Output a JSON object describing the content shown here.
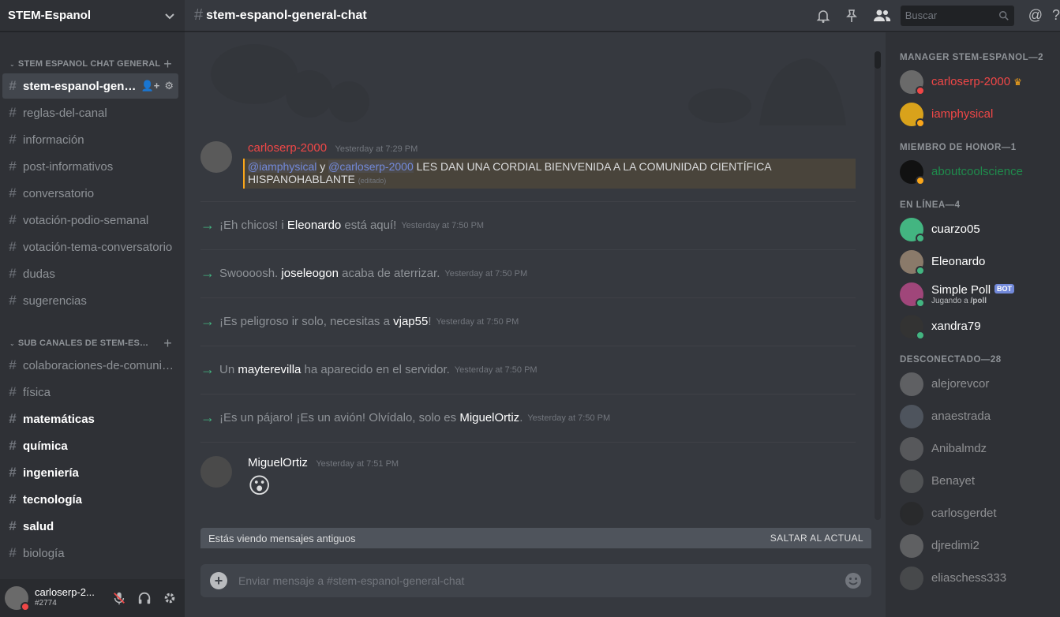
{
  "server": {
    "name": "STEM-Espanol"
  },
  "categories": [
    {
      "name": "STEM ESPANOL CHAT GENERAL",
      "channels": [
        {
          "name": "stem-espanol-general-chat",
          "state": "active"
        },
        {
          "name": "reglas-del-canal",
          "state": "normal"
        },
        {
          "name": "información",
          "state": "normal"
        },
        {
          "name": "post-informativos",
          "state": "normal"
        },
        {
          "name": "conversatorio",
          "state": "normal"
        },
        {
          "name": "votación-podio-semanal",
          "state": "normal"
        },
        {
          "name": "votación-tema-conversatorio",
          "state": "normal"
        },
        {
          "name": "dudas",
          "state": "normal"
        },
        {
          "name": "sugerencias",
          "state": "normal"
        }
      ]
    },
    {
      "name": "SUB CANALES DE STEM-ESPANOL",
      "channels": [
        {
          "name": "colaboraciones-de-comunidad",
          "state": "normal"
        },
        {
          "name": "física",
          "state": "normal"
        },
        {
          "name": "matemáticas",
          "state": "unread"
        },
        {
          "name": "química",
          "state": "unread"
        },
        {
          "name": "ingeniería",
          "state": "unread"
        },
        {
          "name": "tecnología",
          "state": "unread"
        },
        {
          "name": "salud",
          "state": "unread"
        },
        {
          "name": "biología",
          "state": "normal"
        }
      ]
    }
  ],
  "user_panel": {
    "username": "carloserp-2...",
    "tag": "#2774"
  },
  "topbar": {
    "channel_name": "stem-espanol-general-chat",
    "search_placeholder": "Buscar"
  },
  "messages": {
    "first": {
      "author": "carloserp-2000",
      "author_color": "#f04747",
      "timestamp": "Yesterday at 7:29 PM",
      "mention1": "@iamphysical",
      "joiner": "y",
      "mention2": "@carloserp-2000",
      "text": "LES DAN UNA CORDIAL BIENVENIDA A LA COMUNIDAD CIENTÍFICA HISPANOHABLANTE",
      "edited": "(editado)"
    },
    "system": [
      {
        "before": "¡Eh chicos! i ",
        "user": "Eleonardo",
        "after": " está aquí!",
        "timestamp": "Yesterday at 7:50 PM"
      },
      {
        "before": "Swoooosh. ",
        "user": "joseleogon",
        "after": " acaba de aterrizar.",
        "timestamp": "Yesterday at 7:50 PM"
      },
      {
        "before": "¡Es peligroso ir solo, necesitas a ",
        "user": "vjap55",
        "after": "!",
        "timestamp": "Yesterday at 7:50 PM"
      },
      {
        "before": "Un ",
        "user": "mayterevilla",
        "after": " ha aparecido en el servidor.",
        "timestamp": "Yesterday at 7:50 PM"
      },
      {
        "before": "¡Es un pájaro! ¡Es un avión! Olvídalo, solo es ",
        "user": "MiguelOrtiz",
        "after": ".",
        "timestamp": "Yesterday at 7:50 PM"
      }
    ],
    "last": {
      "author": "MiguelOrtiz",
      "timestamp": "Yesterday at 7:51 PM",
      "emoji": "😮"
    }
  },
  "old_messages_bar": {
    "text": "Estás viendo mensajes antiguos",
    "jump": "SALTAR AL ACTUAL"
  },
  "composer": {
    "placeholder": "Enviar mensaje a #stem-espanol-general-chat"
  },
  "members": {
    "groups": [
      {
        "title": "MANAGER STEM-ESPANOL—2",
        "items": [
          {
            "name": "carloserp-2000",
            "color": "#f04747",
            "status": "dnd",
            "crown": true,
            "avatar": "#6a6a6a"
          },
          {
            "name": "iamphysical",
            "color": "#f04747",
            "status": "idle",
            "avatar": "#d9a21b"
          }
        ]
      },
      {
        "title": "MIEMBRO DE HONOR—1",
        "items": [
          {
            "name": "aboutcoolscience",
            "color": "#1f8b4c",
            "status": "idle",
            "avatar": "#111111"
          }
        ]
      },
      {
        "title": "EN LÍNEA—4",
        "items": [
          {
            "name": "cuarzo05",
            "color": "#ffffff",
            "status": "online",
            "avatar": "#43b581"
          },
          {
            "name": "Eleonardo",
            "color": "#ffffff",
            "status": "online",
            "avatar": "#8a7a6a"
          },
          {
            "name": "Simple Poll",
            "color": "#ffffff",
            "status": "online",
            "bot": "BOT",
            "activity_prefix": "Jugando a ",
            "activity": "/poll",
            "avatar": "#a0467a"
          },
          {
            "name": "xandra79",
            "color": "#ffffff",
            "status": "online",
            "avatar": "#333333"
          }
        ]
      },
      {
        "title": "DESCONECTADO—28",
        "items": [
          {
            "name": "alejorevcor",
            "avatar": "#9a9a9a"
          },
          {
            "name": "anaestrada",
            "avatar": "#747f8d"
          },
          {
            "name": "Anibalmdz",
            "avatar": "#888888"
          },
          {
            "name": "Benayet",
            "avatar": "#7a7a7a"
          },
          {
            "name": "carlosgerdet",
            "avatar": "#222222"
          },
          {
            "name": "djredimi2",
            "avatar": "#999999"
          },
          {
            "name": "eliaschess333",
            "avatar": "#666666"
          }
        ]
      }
    ]
  }
}
